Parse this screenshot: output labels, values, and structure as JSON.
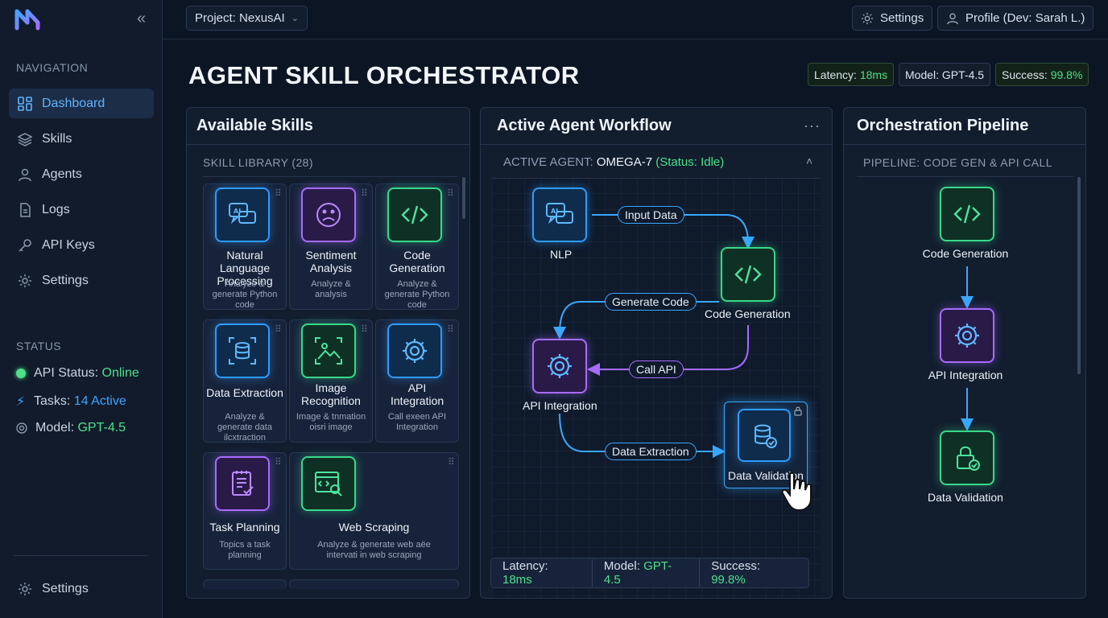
{
  "sidebar": {
    "nav_heading": "NAVIGATION",
    "items": [
      {
        "label": "Dashboard",
        "icon": "dashboard-icon"
      },
      {
        "label": "Skills",
        "icon": "layers-icon"
      },
      {
        "label": "Agents",
        "icon": "users-icon"
      },
      {
        "label": "Logs",
        "icon": "document-icon"
      },
      {
        "label": "API Keys",
        "icon": "key-icon"
      },
      {
        "label": "Settings",
        "icon": "gear-icon"
      }
    ],
    "status_heading": "STATUS",
    "status": {
      "api_label": "API Status:",
      "api_value": "Online",
      "tasks_label": "Tasks:",
      "tasks_value": "14 Active",
      "model_label": "Model:",
      "model_value": "GPT-4.5"
    },
    "footer_settings": "Settings"
  },
  "topbar": {
    "project": "Project: NexusAI",
    "settings": "Settings",
    "profile": "Profile (Dev: Sarah L.)"
  },
  "header": {
    "title": "AGENT SKILL ORCHESTRATOR",
    "metrics": {
      "latency_label": "Latency:",
      "latency_value": "18ms",
      "model_label": "Model:",
      "model_value": "GPT-4.5",
      "success_label": "Success:",
      "success_value": "99.8%"
    }
  },
  "skills_panel": {
    "title": "Available Skills",
    "library_label": "SKILL LIBRARY (28)",
    "skills": [
      {
        "name": "Natural Language Processing",
        "desc": "Analyze & generate Python code",
        "icon": "chat-ai-icon",
        "color": "#2f9bff"
      },
      {
        "name": "Sentiment Analysis",
        "desc": "Analyze & analysis",
        "icon": "sad-face-icon",
        "color": "#a66cff"
      },
      {
        "name": "Code Generation",
        "desc": "Analyze & generate Python code",
        "icon": "code-icon",
        "color": "#38d98a"
      },
      {
        "name": "Data Extraction",
        "desc": "Analyze & generate data ilcxtraction",
        "icon": "database-scan-icon",
        "color": "#2f9bff"
      },
      {
        "name": "Image Recognition",
        "desc": "Image & tnmation oisri image",
        "icon": "image-scan-icon",
        "color": "#38d98a"
      },
      {
        "name": "API Integration",
        "desc": "Call exeen API Integration",
        "icon": "gear-icon",
        "color": "#2f9bff"
      },
      {
        "name": "Task Planning",
        "desc": "Topics a task planning",
        "icon": "checklist-icon",
        "color": "#a66cff"
      },
      {
        "name": "Web Scraping",
        "desc": "Analyze & generate web aëe intervati in web scraping",
        "icon": "web-search-icon",
        "color": "#38d98a"
      }
    ]
  },
  "workflow_panel": {
    "title": "Active Agent Workflow",
    "agent_label": "ACTIVE AGENT:",
    "agent_name": "OMEGA-7",
    "agent_status": "(Status: Idle)",
    "nodes": {
      "nlp": "NLP",
      "code": "Code Generation",
      "api": "API Integration",
      "validation": "Data Validation"
    },
    "edges": {
      "input": "Input Data",
      "generate": "Generate Code",
      "call": "Call API",
      "extract": "Data Extraction"
    },
    "footer": {
      "latency_label": "Latency:",
      "latency_value": "18ms",
      "model_label": "Model:",
      "model_value": "GPT-4.5",
      "success_label": "Success:",
      "success_value": "99.8%"
    }
  },
  "pipeline_panel": {
    "title": "Orchestration Pipeline",
    "pipeline_label": "PIPELINE: CODE GEN & API CALL",
    "steps": [
      {
        "label": "Code Generation",
        "icon": "code-icon"
      },
      {
        "label": "API Integration",
        "icon": "gear-icon"
      },
      {
        "label": "Data Validation",
        "icon": "lock-check-icon"
      }
    ]
  }
}
